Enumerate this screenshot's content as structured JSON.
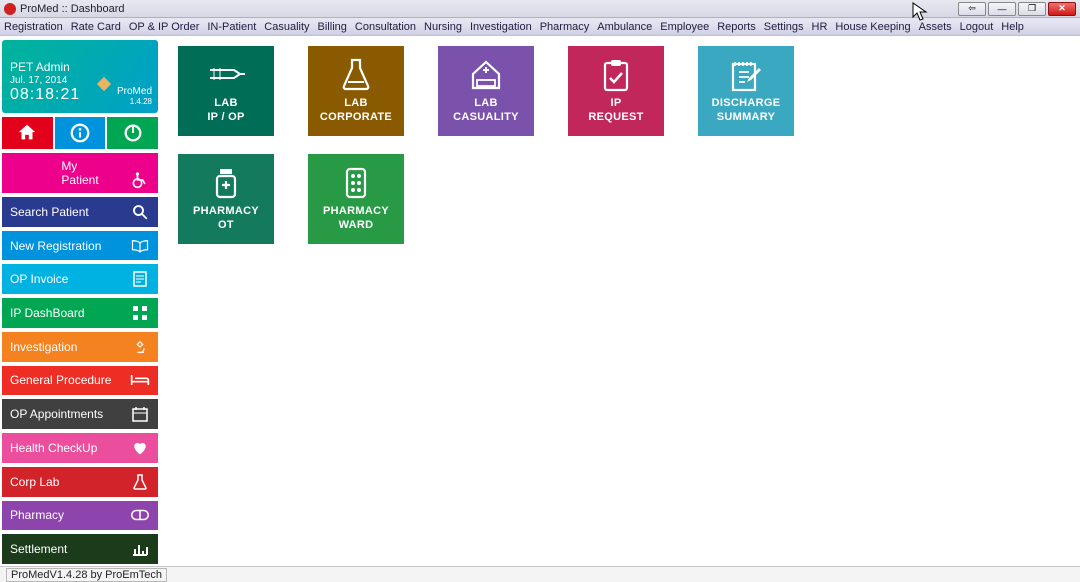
{
  "window": {
    "title": "ProMed :: Dashboard"
  },
  "menu": [
    "Registration",
    "Rate Card",
    "OP & IP Order",
    "IN-Patient",
    "Casuality",
    "Billing",
    "Consultation",
    "Nursing",
    "Investigation",
    "Pharmacy",
    "Ambulance",
    "Employee",
    "Reports",
    "Settings",
    "HR",
    "House Keeping",
    "Assets",
    "Logout",
    "Help"
  ],
  "user": {
    "name": "PET Admin",
    "date": "Jul. 17, 2014",
    "time": "08:18:21",
    "brand": "ProMed",
    "version": "1.4.28"
  },
  "sidebar": {
    "mypatient": "My Patient",
    "search": "Search Patient",
    "newreg": "New Registration",
    "opinvoice": "OP Invoice",
    "ipdash": "IP DashBoard",
    "investigation": "Investigation",
    "genproc": "General Procedure",
    "opappt": "OP Appointments",
    "health": "Health CheckUp",
    "corplab": "Corp Lab",
    "pharmacy": "Pharmacy",
    "settlement": "Settlement"
  },
  "tiles": {
    "labipop": {
      "l1": "LAB",
      "l2": "IP / OP"
    },
    "labcorp": {
      "l1": "LAB",
      "l2": "CORPORATE"
    },
    "labcas": {
      "l1": "LAB",
      "l2": "CASUALITY"
    },
    "ipreq": {
      "l1": "IP",
      "l2": "REQUEST"
    },
    "discharge": {
      "l1": "DISCHARGE",
      "l2": "SUMMARY"
    },
    "pharmot": {
      "l1": "PHARMACY",
      "l2": "OT"
    },
    "pharmward": {
      "l1": "PHARMACY",
      "l2": "WARD"
    }
  },
  "status": "ProMedV1.4.28 by ProEmTech"
}
